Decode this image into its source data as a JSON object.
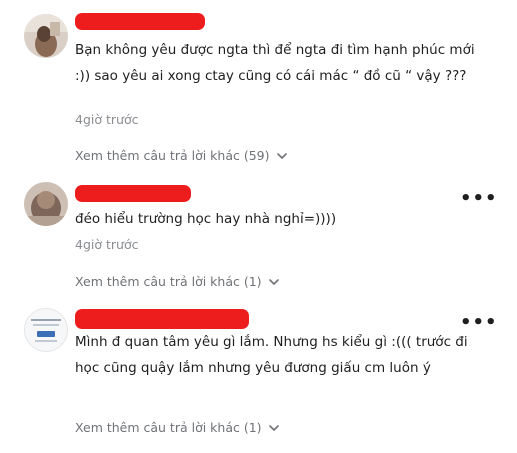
{
  "comments": [
    {
      "name": "",
      "text": "Bạn không yêu được ngta thì để ngta đi tìm hạnh phúc mới :)) sao yêu ai xong ctay cũng có cái mác “ đồ cũ “ vậy ???",
      "time": "4giờ trước",
      "more_replies": "Xem thêm câu trả lời khác (59)",
      "has_menu": false
    },
    {
      "name": "",
      "text": "đéo hiểu trường học hay nhà nghỉ=))))",
      "time": "4giờ trước",
      "more_replies": "Xem thêm câu trả lời khác (1)",
      "has_menu": true
    },
    {
      "name": "",
      "text": "Mình đ quan tâm yêu gì lắm. Nhưng hs kiểu gì :((( trước đi học cũng quậy lắm nhưng yêu đương giấu cm luôn ý",
      "time": "",
      "more_replies": "Xem thêm câu trả lời khác (1)",
      "has_menu": true
    }
  ],
  "menu_glyph": "•••",
  "colors": {
    "redaction": "#ee1d1d",
    "text": "#1f1f1f",
    "muted": "#8a8d91"
  },
  "icons": [
    "avatar-photo",
    "chevron-down-icon",
    "more-options-icon"
  ]
}
